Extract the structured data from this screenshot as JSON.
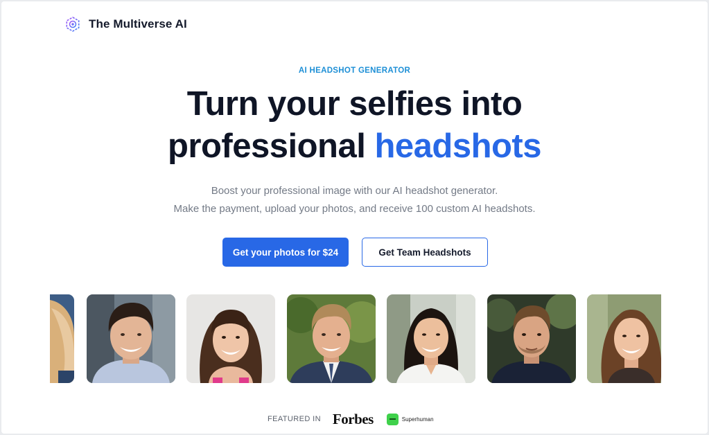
{
  "brand": {
    "name": "The Multiverse AI",
    "logo_icon": "multiverse-logo-icon"
  },
  "hero": {
    "eyebrow": "AI HEADSHOT GENERATOR",
    "headline_line1": "Turn your selfies into",
    "headline_line2_plain": "professional ",
    "headline_line2_accent": "headshots",
    "subtitle_line1": "Boost your professional image with our AI headshot generator.",
    "subtitle_line2": "Make the payment, upload your photos, and receive 100 custom AI headshots."
  },
  "buttons": {
    "primary": "Get your photos for $24",
    "secondary": "Get Team Headshots"
  },
  "gallery": {
    "photos": [
      "partial-woman-blonde-headshot",
      "smiling-man-dark-hair-headshot",
      "smiling-woman-bangs-headshot",
      "man-suit-tie-headshot",
      "smiling-woman-white-blouse-headshot",
      "man-navy-shirt-headshot",
      "smiling-woman-brown-hair-headshot"
    ]
  },
  "featured": {
    "label": "FEATURED IN",
    "forbes": "Forbes",
    "superhuman": "Superhuman",
    "superhuman_icon": "superhuman-logo-icon"
  },
  "colors": {
    "accent": "#2868e6",
    "eyebrow": "#1d8fd6",
    "heading": "#0f1526",
    "muted": "#737a86"
  }
}
